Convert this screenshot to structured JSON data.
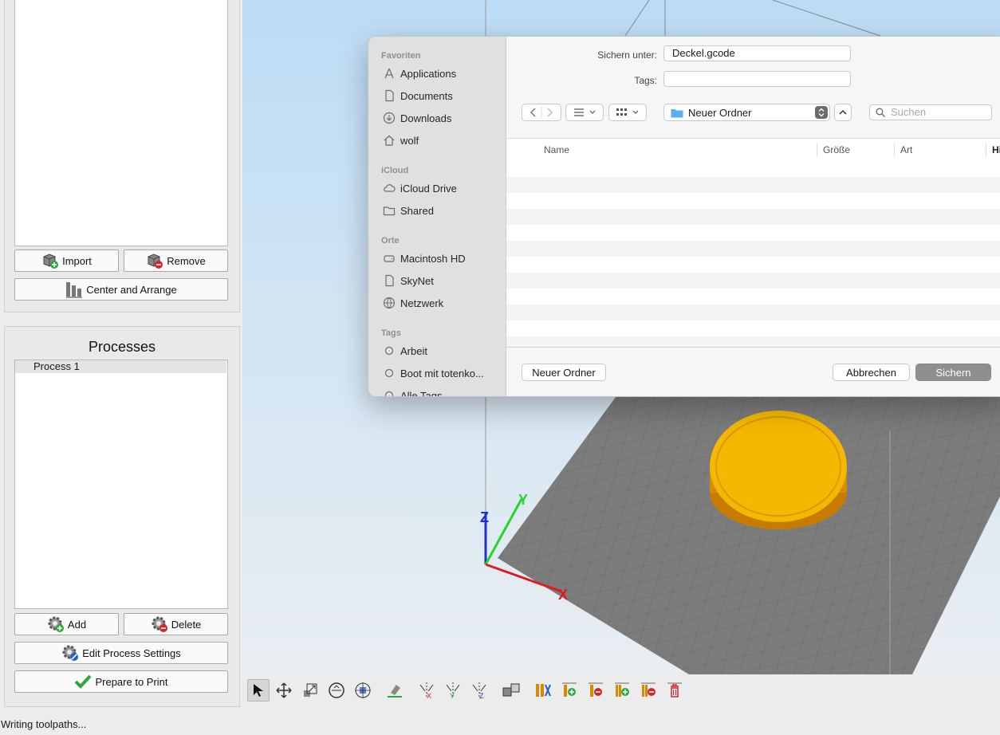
{
  "left_panel": {
    "buttons": {
      "import": "Import",
      "remove": "Remove",
      "center_arrange": "Center and Arrange"
    },
    "processes": {
      "title": "Processes",
      "items": [
        "Process 1"
      ],
      "add": "Add",
      "delete": "Delete",
      "edit_settings": "Edit Process Settings",
      "prepare": "Prepare to Print"
    }
  },
  "status": {
    "text": "Writing toolpaths..."
  },
  "viewport": {
    "axis_labels": {
      "x": "X",
      "y": "Y",
      "z": "Z"
    },
    "colors": {
      "object": "#f5b800",
      "bed": "#7a7a7a",
      "x_axis": "#e01b1b",
      "y_axis": "#27d42a",
      "z_axis": "#1c2fd6"
    }
  },
  "toolbar": {
    "icons": [
      "select-icon",
      "move-icon",
      "scale-icon",
      "rotate-icon",
      "placement-icon",
      "lay-flat-icon",
      "mirror-x-icon",
      "mirror-y-icon",
      "mirror-z-icon",
      "split-icon",
      "layout-icon",
      "add-support-icon",
      "remove-support-icon",
      "add-modifier-icon",
      "remove-modifier-icon",
      "trash-icon"
    ]
  },
  "save_dialog": {
    "save_as_label": "Sichern unter:",
    "filename": "Deckel.gcode",
    "tags_label": "Tags:",
    "tags_value": "",
    "location": "Neuer Ordner",
    "search_placeholder": "Suchen",
    "columns": {
      "name": "Name",
      "size": "Größe",
      "kind": "Art",
      "added": "Hi"
    },
    "new_folder": "Neuer Ordner",
    "cancel": "Abbrechen",
    "save": "Sichern",
    "sidebar": {
      "favorites_title": "Favoriten",
      "favorites": [
        {
          "label": "Applications",
          "icon": "applications-icon"
        },
        {
          "label": "Documents",
          "icon": "document-icon"
        },
        {
          "label": "Downloads",
          "icon": "downloads-icon"
        },
        {
          "label": "wolf",
          "icon": "home-icon"
        }
      ],
      "icloud_title": "iCloud",
      "icloud": [
        {
          "label": "iCloud Drive",
          "icon": "cloud-icon"
        },
        {
          "label": "Shared",
          "icon": "shared-folder-icon"
        }
      ],
      "locations_title": "Orte",
      "locations": [
        {
          "label": "Macintosh HD",
          "icon": "disk-icon"
        },
        {
          "label": "SkyNet",
          "icon": "document-icon"
        },
        {
          "label": "Netzwerk",
          "icon": "globe-icon"
        }
      ],
      "tags_title": "Tags",
      "tags": [
        {
          "label": "Arbeit",
          "icon": "tag-circle-icon"
        },
        {
          "label": "Boot mit totenko...",
          "icon": "tag-circle-icon"
        },
        {
          "label": "Alle Tags...",
          "icon": "tag-circle-icon"
        }
      ]
    }
  }
}
